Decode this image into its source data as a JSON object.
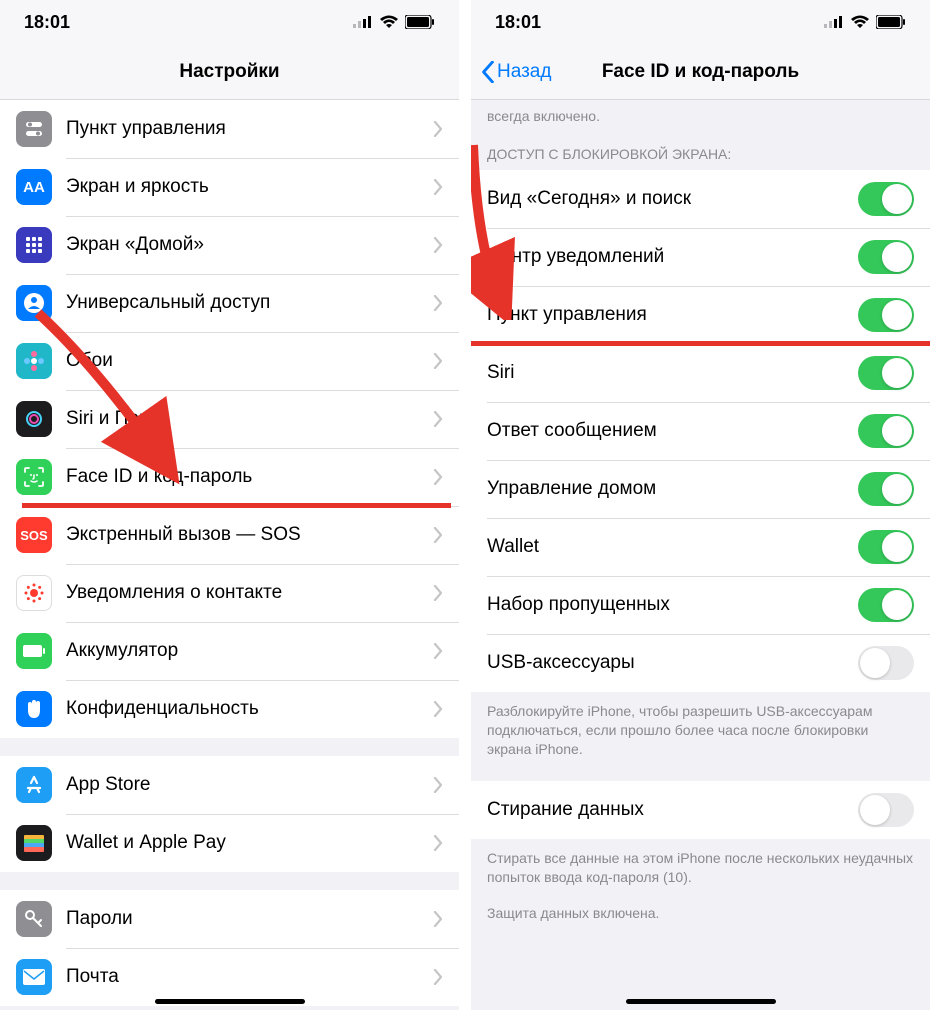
{
  "status": {
    "time": "18:01"
  },
  "left": {
    "title": "Настройки",
    "groups": [
      {
        "rows": [
          {
            "key": "control-center",
            "label": "Пункт управления",
            "icon_bg": "#8e8e93",
            "icon": "switches"
          },
          {
            "key": "display",
            "label": "Экран и яркость",
            "icon_bg": "#007aff",
            "icon": "AA"
          },
          {
            "key": "home-screen",
            "label": "Экран «Домой»",
            "icon_bg": "#3a3abf",
            "icon": "grid"
          },
          {
            "key": "accessibility",
            "label": "Универсальный доступ",
            "icon_bg": "#007aff",
            "icon": "person-circle"
          },
          {
            "key": "wallpaper",
            "label": "Обои",
            "icon_bg": "#20b8c9",
            "icon": "flower"
          },
          {
            "key": "siri",
            "label": "Siri и Поиск",
            "icon_bg": "#1c1c1e",
            "icon": "siri"
          },
          {
            "key": "faceid",
            "label": "Face ID и код-пароль",
            "icon_bg": "#30d158",
            "icon": "faceid",
            "highlight": true
          },
          {
            "key": "sos",
            "label": "Экстренный вызов — SOS",
            "icon_bg": "#ff3b30",
            "icon": "SOS"
          },
          {
            "key": "exposure",
            "label": "Уведомления о контакте",
            "icon_bg": "#ffffff",
            "icon": "exposure"
          },
          {
            "key": "battery",
            "label": "Аккумулятор",
            "icon_bg": "#30d158",
            "icon": "battery"
          },
          {
            "key": "privacy",
            "label": "Конфиденциальность",
            "icon_bg": "#007aff",
            "icon": "hand"
          }
        ]
      },
      {
        "rows": [
          {
            "key": "appstore",
            "label": "App Store",
            "icon_bg": "#1e9ff5",
            "icon": "appstore"
          },
          {
            "key": "wallet",
            "label": "Wallet и Apple Pay",
            "icon_bg": "#1c1c1e",
            "icon": "wallet"
          }
        ]
      },
      {
        "rows": [
          {
            "key": "passwords",
            "label": "Пароли",
            "icon_bg": "#8e8e93",
            "icon": "key"
          },
          {
            "key": "mail",
            "label": "Почта",
            "icon_bg": "#1e9ff5",
            "icon": "mail"
          }
        ]
      }
    ]
  },
  "right": {
    "back": "Назад",
    "title": "Face ID и код-пароль",
    "top_text": "всегда включено.",
    "section_header": "ДОСТУП С БЛОКИРОВКОЙ ЭКРАНА:",
    "toggles": [
      {
        "key": "today",
        "label": "Вид «Сегодня» и поиск",
        "on": true
      },
      {
        "key": "notif",
        "label": "Центр уведомлений",
        "on": true
      },
      {
        "key": "control",
        "label": "Пункт управления",
        "on": true,
        "highlight": true
      },
      {
        "key": "siri",
        "label": "Siri",
        "on": true
      },
      {
        "key": "reply",
        "label": "Ответ сообщением",
        "on": true
      },
      {
        "key": "home",
        "label": "Управление домом",
        "on": true
      },
      {
        "key": "wallet",
        "label": "Wallet",
        "on": true
      },
      {
        "key": "missed",
        "label": "Набор пропущенных",
        "on": true
      },
      {
        "key": "usb",
        "label": "USB-аксессуары",
        "on": false
      }
    ],
    "usb_footer": "Разблокируйте iPhone, чтобы разрешить USB-аксессуарам подключаться, если прошло более часа после блокировки экрана iPhone.",
    "erase": {
      "label": "Стирание данных",
      "on": false
    },
    "erase_footer": "Стирать все данные на этом iPhone после нескольких неудачных попыток ввода код-пароля (10).",
    "protection": "Защита данных включена."
  }
}
